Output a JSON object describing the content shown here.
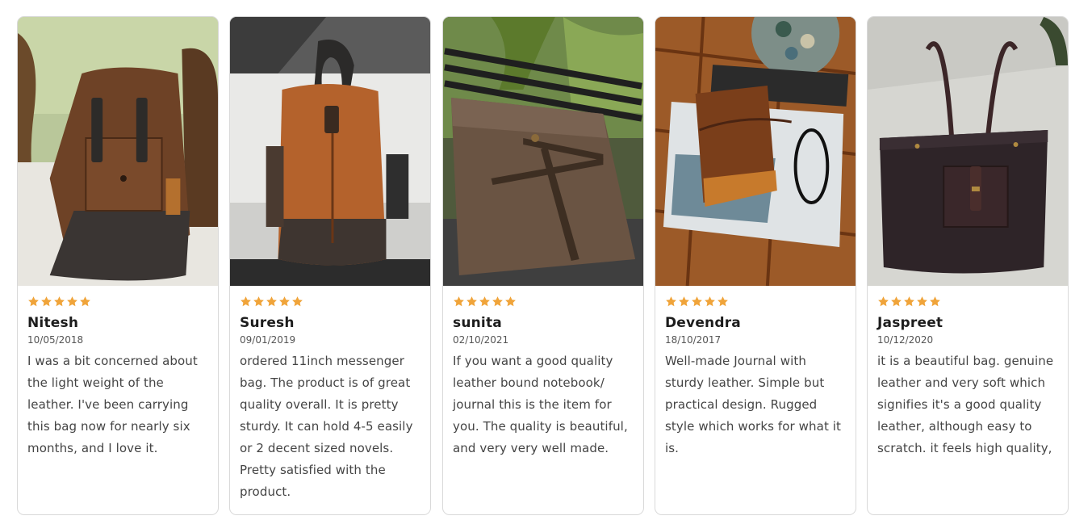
{
  "star_color": "#f0a43a",
  "reviews": [
    {
      "photo": "brown-leather-backpack-photo",
      "rating": 5,
      "name": "Nitesh",
      "date": "10/05/2018",
      "text": "I was a bit concerned about the light weight of the leather. I've been carrying this bag now for nearly six months, and I love it."
    },
    {
      "photo": "tan-leather-backpack-photo",
      "rating": 5,
      "name": "Suresh",
      "date": "09/01/2019",
      "text": "ordered 11inch messenger bag. The product is of great quality overall. It is pretty sturdy. It can hold 4-5 easily or 2 decent sized novels. Pretty satisfied with the product."
    },
    {
      "photo": "leather-journal-on-window-photo",
      "rating": 5,
      "name": "sunita",
      "date": "02/10/2021",
      "text": "If you want a good quality leather bound notebook/ journal this is the item for you. The quality is beautiful, and very very well made."
    },
    {
      "photo": "leather-journal-on-table-photo",
      "rating": 5,
      "name": "Devendra",
      "date": "18/10/2017",
      "text": "Well-made Journal with sturdy leather. Simple but practical design. Rugged style which works for what it is."
    },
    {
      "photo": "dark-leather-tote-bag-photo",
      "rating": 5,
      "name": "Jaspreet",
      "date": "10/12/2020",
      "text": "it is a beautiful bag. genuine leather and very soft which signifies it's a good quality leather, although easy to scratch. it feels high quality,"
    }
  ]
}
